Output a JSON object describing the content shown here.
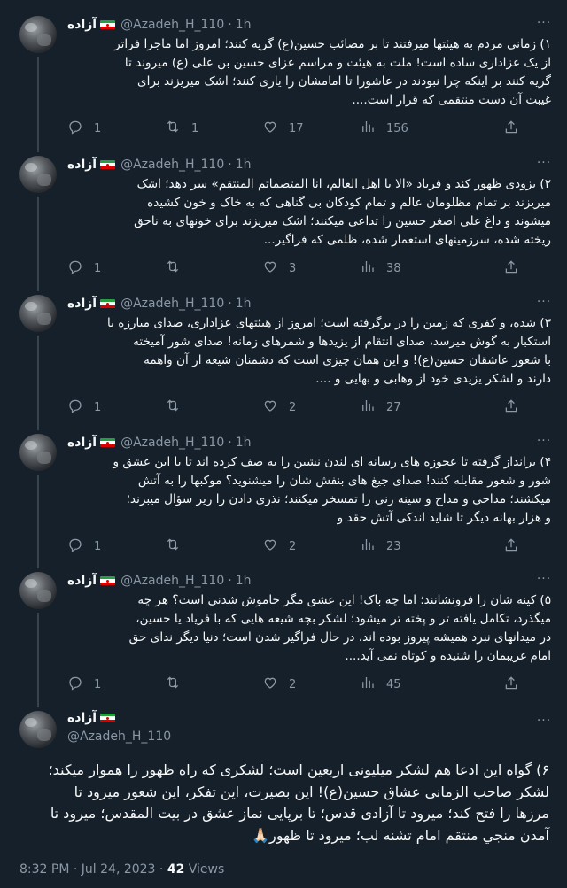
{
  "author": {
    "name": "آزاده",
    "flag": "iran-flag",
    "handle": "@Azadeh_H_110",
    "separator": "·"
  },
  "tweets": [
    {
      "time": "1h",
      "text": "۱) زمانی مردم به هیئتها میرفتند تا بر مصائب حسین(ع) گریه کنند؛ امروز اما ماجرا فراتر\nاز یک عزاداری ساده است! ملت به هیئت و مراسم عزای حسین بن علی (ع) میروند تا\nگریه کنند بر اینکه چرا نبودند در عاشورا تا امامشان را یاری کنند؛ اشک میریزند برای\nغیبت آن دست منتقمی که قرار است....",
      "replies": "1",
      "retweets": "1",
      "likes": "17",
      "views": "156"
    },
    {
      "time": "1h",
      "text": "۲) بزودی ظهور کند و فریاد «الا یا اهل العالم، انا المتصماتم المنتقم» سر دهد؛ اشک\nمیریزند بر تمام مظلومان عالم و تمام کودکان بی گناهی که به خاک و خون کشیده\nمیشوند و داغ علی اصغر حسین را تداعی میکنند؛ اشک میریزند برای خونهای به ناحق\nریخته شده، سرزمینهای استعمار شده، ظلمی که فراگیر...",
      "replies": "1",
      "retweets": "",
      "likes": "3",
      "views": "38"
    },
    {
      "time": "1h",
      "text": "۳) شده، و کفری که زمین را در برگرفته است؛ امروز از هیئتهای عزاداری، صدای مبارزه با\nاستکبار به گوش میرسد، صدای انتقام از یزیدها و شمرهای زمانه! صدای شور آمیخته\nبا شعور عاشقان حسین(ع)! و این همان چیزی است که دشمنان شیعه از آن واهمه\nدارند و لشکر یزیدی خود از وهابی و بهایی و ....",
      "replies": "1",
      "retweets": "",
      "likes": "2",
      "views": "27"
    },
    {
      "time": "1h",
      "text": "۴) برانداز گرفته تا عجوزه های رسانه ای  لندن نشین را به صف کرده اند تا با این عشق و\nشور و شعور مقابله کنند! صدای جیغ های بنفش شان را میشنوید؟ موکبها را به آتش\nمیکشند؛ مداحی و مداح و سینه زنی را تمسخر میکنند؛ نذری دادن را زیر سؤال میبرند؛\nو هزار بهانه دیگر تا شاید اندکی آتش حقد و",
      "replies": "1",
      "retweets": "",
      "likes": "2",
      "views": "23"
    },
    {
      "time": "1h",
      "text": "۵) کینه شان را فرونشانند؛ اما چه باک! این عشق مگر خاموش شدنی است؟ هر چه\nمیگذرد، تکامل یافته تر و پخته تر میشود؛ لشکر بچه شیعه هایی که با فریاد یا حسین،\nدر میدانهای نبرد همیشه پیروز بوده اند، در حال فراگیر شدن است؛ دنیا دیگر ندای حق\nامام غریبمان را شنیده و کوتاه نمی آید....",
      "replies": "1",
      "retweets": "",
      "likes": "2",
      "views": "45"
    }
  ],
  "main_tweet": {
    "text": "۶) گواه این ادعا هم لشکر میلیونی اربعین است؛ لشکری که راه ظهور را هموار میکند؛\nلشکر صاحب الزمانی عشاق حسین(ع)! این بصیرت، این تفکر، این شعور میرود تا\nمرزها را فتح کند؛ میرود تا آزادی قدس؛ تا برپایی نماز عشق در بیت المقدس؛ میرود تا\nآمدن منجي منتقم امام تشنه لب؛ میرود تا ظهور🙏🏻",
    "time": "8:32 PM",
    "date": "Jul 24, 2023",
    "views_count": "42",
    "views_label": "Views"
  }
}
